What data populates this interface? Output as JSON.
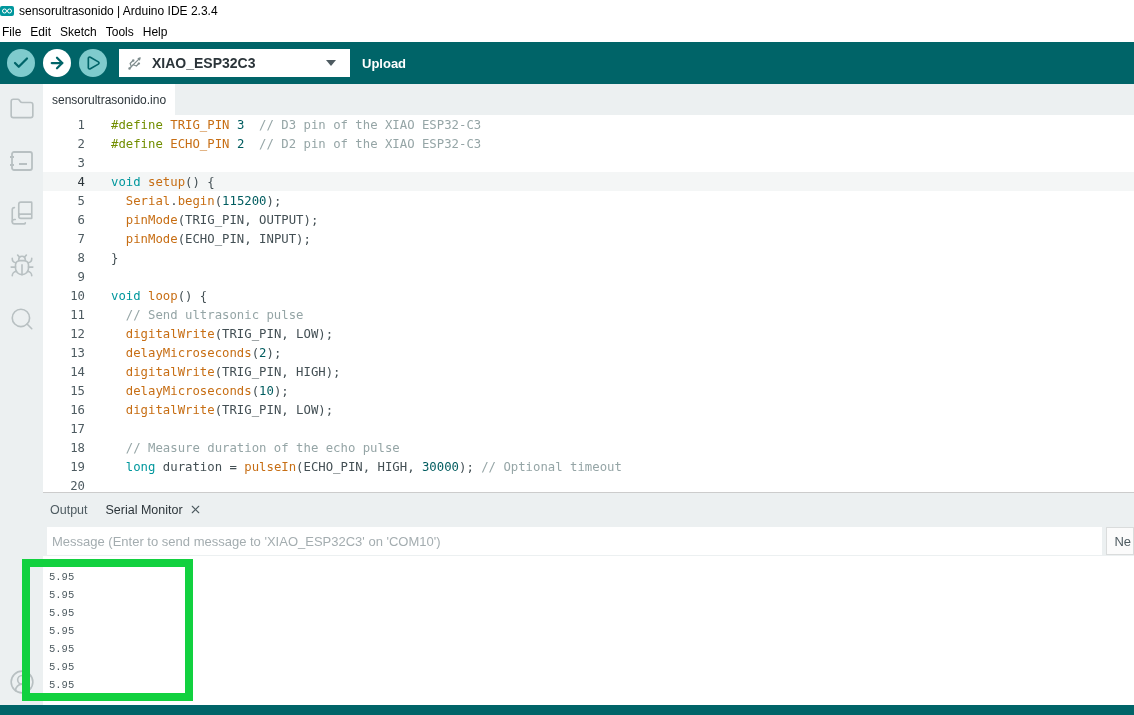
{
  "window": {
    "title": "sensorultrasonido | Arduino IDE 2.3.4"
  },
  "menu": [
    "File",
    "Edit",
    "Sketch",
    "Tools",
    "Help"
  ],
  "toolbar": {
    "buttons": [
      {
        "kind": "verify",
        "selected": false
      },
      {
        "kind": "upload",
        "selected": true
      },
      {
        "kind": "debug",
        "selected": false
      }
    ],
    "board": "XIAO_ESP32C3",
    "hint": "Upload"
  },
  "sidebar": {
    "items": [
      {
        "kind": "folder"
      },
      {
        "kind": "board"
      },
      {
        "kind": "library"
      },
      {
        "kind": "debug"
      },
      {
        "kind": "search"
      }
    ]
  },
  "editor": {
    "tabs": [
      {
        "label": "sensorultrasonido.ino",
        "selected": true
      }
    ],
    "lines": [
      {
        "number": "1",
        "current": false,
        "tokens": [
          {
            "kind": "preprocessor",
            "text": "#define "
          },
          {
            "kind": "constant",
            "text": "TRIG_PIN "
          },
          {
            "kind": "number",
            "text": "3  "
          },
          {
            "kind": "comment",
            "text": "// D3 pin of the XIAO ESP32-C3"
          }
        ]
      },
      {
        "number": "2",
        "current": false,
        "tokens": [
          {
            "kind": "preprocessor",
            "text": "#define "
          },
          {
            "kind": "constant",
            "text": "ECHO_PIN "
          },
          {
            "kind": "number",
            "text": "2  "
          },
          {
            "kind": "comment",
            "text": "// D2 pin of the XIAO ESP32-C3"
          }
        ]
      },
      {
        "number": "3",
        "current": false
      },
      {
        "number": "4",
        "current": true,
        "tokens": [
          {
            "kind": "keyword",
            "text": "void "
          },
          {
            "kind": "function",
            "text": "setup"
          },
          {
            "kind": "plain",
            "text": "() {"
          }
        ]
      },
      {
        "number": "5",
        "current": false,
        "tokens": [
          {
            "kind": "function",
            "text": "  Serial"
          },
          {
            "kind": "plain",
            "text": "."
          },
          {
            "kind": "function",
            "text": "begin"
          },
          {
            "kind": "plain",
            "text": "("
          },
          {
            "kind": "number",
            "text": "115200"
          },
          {
            "kind": "plain",
            "text": ");"
          }
        ]
      },
      {
        "number": "6",
        "current": false,
        "tokens": [
          {
            "kind": "function",
            "text": "  pinMode"
          },
          {
            "kind": "plain",
            "text": "(TRIG_PIN, OUTPUT);"
          }
        ]
      },
      {
        "number": "7",
        "current": false,
        "tokens": [
          {
            "kind": "function",
            "text": "  pinMode"
          },
          {
            "kind": "plain",
            "text": "(ECHO_PIN, INPUT);"
          }
        ]
      },
      {
        "number": "8",
        "current": false,
        "tokens": [
          {
            "kind": "plain",
            "text": "}"
          }
        ]
      },
      {
        "number": "9",
        "current": false
      },
      {
        "number": "10",
        "current": false,
        "tokens": [
          {
            "kind": "keyword",
            "text": "void "
          },
          {
            "kind": "function",
            "text": "loop"
          },
          {
            "kind": "plain",
            "text": "() {"
          }
        ]
      },
      {
        "number": "11",
        "current": false,
        "tokens": [
          {
            "kind": "comment",
            "text": "  // Send ultrasonic pulse"
          }
        ]
      },
      {
        "number": "12",
        "current": false,
        "tokens": [
          {
            "kind": "function",
            "text": "  digitalWrite"
          },
          {
            "kind": "plain",
            "text": "(TRIG_PIN, LOW);"
          }
        ]
      },
      {
        "number": "13",
        "current": false,
        "tokens": [
          {
            "kind": "function",
            "text": "  delayMicroseconds"
          },
          {
            "kind": "plain",
            "text": "("
          },
          {
            "kind": "number",
            "text": "2"
          },
          {
            "kind": "plain",
            "text": ");"
          }
        ]
      },
      {
        "number": "14",
        "current": false,
        "tokens": [
          {
            "kind": "function",
            "text": "  digitalWrite"
          },
          {
            "kind": "plain",
            "text": "(TRIG_PIN, HIGH);"
          }
        ]
      },
      {
        "number": "15",
        "current": false,
        "tokens": [
          {
            "kind": "function",
            "text": "  delayMicroseconds"
          },
          {
            "kind": "plain",
            "text": "("
          },
          {
            "kind": "number",
            "text": "10"
          },
          {
            "kind": "plain",
            "text": ");"
          }
        ]
      },
      {
        "number": "16",
        "current": false,
        "tokens": [
          {
            "kind": "function",
            "text": "  digitalWrite"
          },
          {
            "kind": "plain",
            "text": "(TRIG_PIN, LOW);"
          }
        ]
      },
      {
        "number": "17",
        "current": false
      },
      {
        "number": "18",
        "current": false,
        "tokens": [
          {
            "kind": "comment",
            "text": "  // Measure duration of the echo pulse"
          }
        ]
      },
      {
        "number": "19",
        "current": false,
        "tokens": [
          {
            "kind": "keyword",
            "text": "  long"
          },
          {
            "kind": "plain",
            "text": " duration = "
          },
          {
            "kind": "function",
            "text": "pulseIn"
          },
          {
            "kind": "plain",
            "text": "(ECHO_PIN, HIGH, "
          },
          {
            "kind": "number",
            "text": "30000"
          },
          {
            "kind": "plain",
            "text": "); "
          },
          {
            "kind": "comment",
            "text": "// Optional timeout"
          }
        ]
      },
      {
        "number": "20",
        "current": false
      }
    ]
  },
  "panel": {
    "tabs": [
      {
        "label": "Output",
        "selected": false,
        "closable": false
      },
      {
        "label": "Serial Monitor",
        "selected": true,
        "closable": true
      }
    ],
    "message": {
      "placeholder": "Message (Enter to send message to 'XIAO_ESP32C3' on 'COM10')"
    },
    "line_ending_button": "Ne",
    "serial_lines": [
      "5.95",
      "5.95",
      "5.95",
      "5.95",
      "5.95",
      "5.95",
      "5.95"
    ]
  }
}
